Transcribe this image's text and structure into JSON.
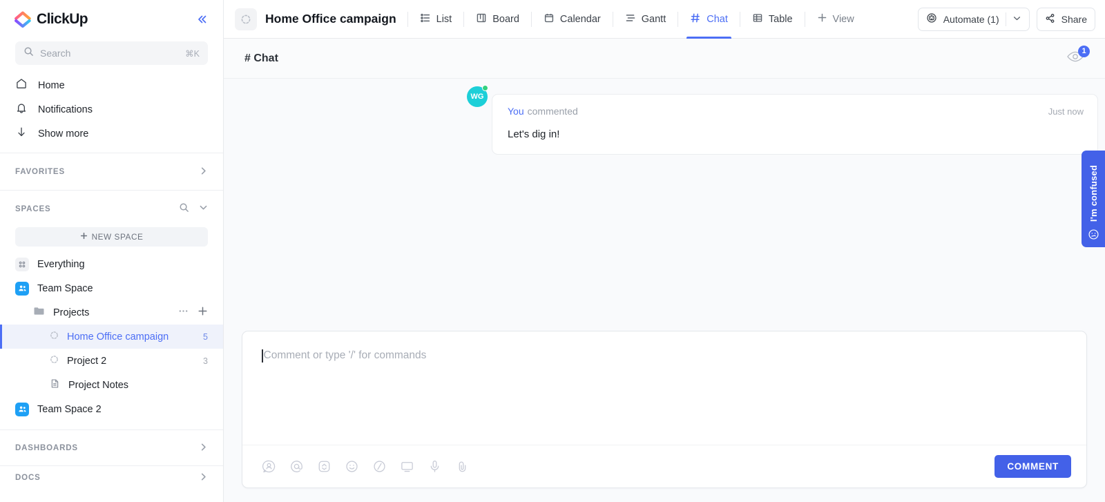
{
  "sidebar": {
    "brand": "ClickUp",
    "collapse_icon": "double-chevron-left-icon",
    "search": {
      "placeholder": "Search",
      "shortcut": "⌘K",
      "icon": "search-icon"
    },
    "nav": [
      {
        "label": "Home",
        "icon": "home-icon"
      },
      {
        "label": "Notifications",
        "icon": "bell-icon"
      },
      {
        "label": "Show more",
        "icon": "arrow-down-icon"
      }
    ],
    "favorites": {
      "title": "FAVORITES",
      "expand_icon": "chevron-right-icon"
    },
    "spaces": {
      "title": "SPACES",
      "search_icon": "search-icon",
      "collapse_icon": "chevron-down-icon",
      "new_space_label": "NEW SPACE",
      "rows": [
        {
          "label": "Everything",
          "icon": "grid-dots-icon",
          "indent": "space",
          "count": ""
        },
        {
          "label": "Team Space",
          "icon": "people-icon",
          "indent": "space",
          "count": ""
        },
        {
          "label": "Projects",
          "icon": "folder-icon",
          "indent": "folder",
          "count": "",
          "actions": [
            "ellipsis-icon",
            "plus-icon"
          ]
        },
        {
          "label": "Home Office campaign",
          "icon": "list-status-icon",
          "indent": "item",
          "count": "5",
          "selected": true
        },
        {
          "label": "Project 2",
          "icon": "list-status-icon",
          "indent": "item",
          "count": "3"
        },
        {
          "label": "Project Notes",
          "icon": "doc-icon",
          "indent": "item",
          "count": ""
        },
        {
          "label": "Team Space 2",
          "icon": "people-icon",
          "indent": "space",
          "count": ""
        }
      ]
    },
    "bottom_sections": [
      {
        "title": "DASHBOARDS",
        "expand_icon": "chevron-right-icon"
      },
      {
        "title": "DOCS",
        "expand_icon": "chevron-right-icon"
      }
    ]
  },
  "topbar": {
    "task_icon": "task-status-spinner-icon",
    "title": "Home Office campaign",
    "tabs": [
      {
        "label": "List",
        "icon": "list-icon",
        "active": false
      },
      {
        "label": "Board",
        "icon": "board-icon",
        "active": false
      },
      {
        "label": "Calendar",
        "icon": "calendar-icon",
        "active": false
      },
      {
        "label": "Gantt",
        "icon": "gantt-icon",
        "active": false
      },
      {
        "label": "Chat",
        "icon": "hash-icon",
        "active": true
      },
      {
        "label": "Table",
        "icon": "table-icon",
        "active": false
      }
    ],
    "add_view_label": "View",
    "add_view_icon": "plus-icon",
    "automate": {
      "label": "Automate (1)",
      "icon": "robot-icon",
      "caret_icon": "chevron-down-icon"
    },
    "share": {
      "label": "Share",
      "icon": "share-icon"
    }
  },
  "chat": {
    "header_title": "# Chat",
    "watchers": {
      "icon": "eye-icon",
      "count": "1"
    },
    "comments": [
      {
        "avatar_initials": "WG",
        "avatar_color": "#1dcfd8",
        "status_dot_color": "#34d17f",
        "author": "You",
        "action": "commented",
        "time": "Just now",
        "text": "Let's dig in!"
      }
    ]
  },
  "composer": {
    "placeholder": "Comment or type '/' for commands",
    "tools": [
      {
        "icon": "assign-person-icon"
      },
      {
        "icon": "mention-at-icon"
      },
      {
        "icon": "clickapp-chevron-icon"
      },
      {
        "icon": "emoji-smiley-icon"
      },
      {
        "icon": "slash-command-icon"
      },
      {
        "icon": "screen-record-icon"
      },
      {
        "icon": "microphone-icon"
      },
      {
        "icon": "attachment-clip-icon"
      }
    ],
    "submit_label": "COMMENT"
  },
  "feedback": {
    "label": "I'm confused",
    "icon": "confused-face-icon"
  },
  "colors": {
    "accent_blue": "#4c6ef5",
    "button_blue": "#4361e8",
    "space_blue": "#1ea0f5",
    "avatar_cyan": "#1dcfd8",
    "online_green": "#34d17f",
    "main_bg": "#f9fafc"
  }
}
